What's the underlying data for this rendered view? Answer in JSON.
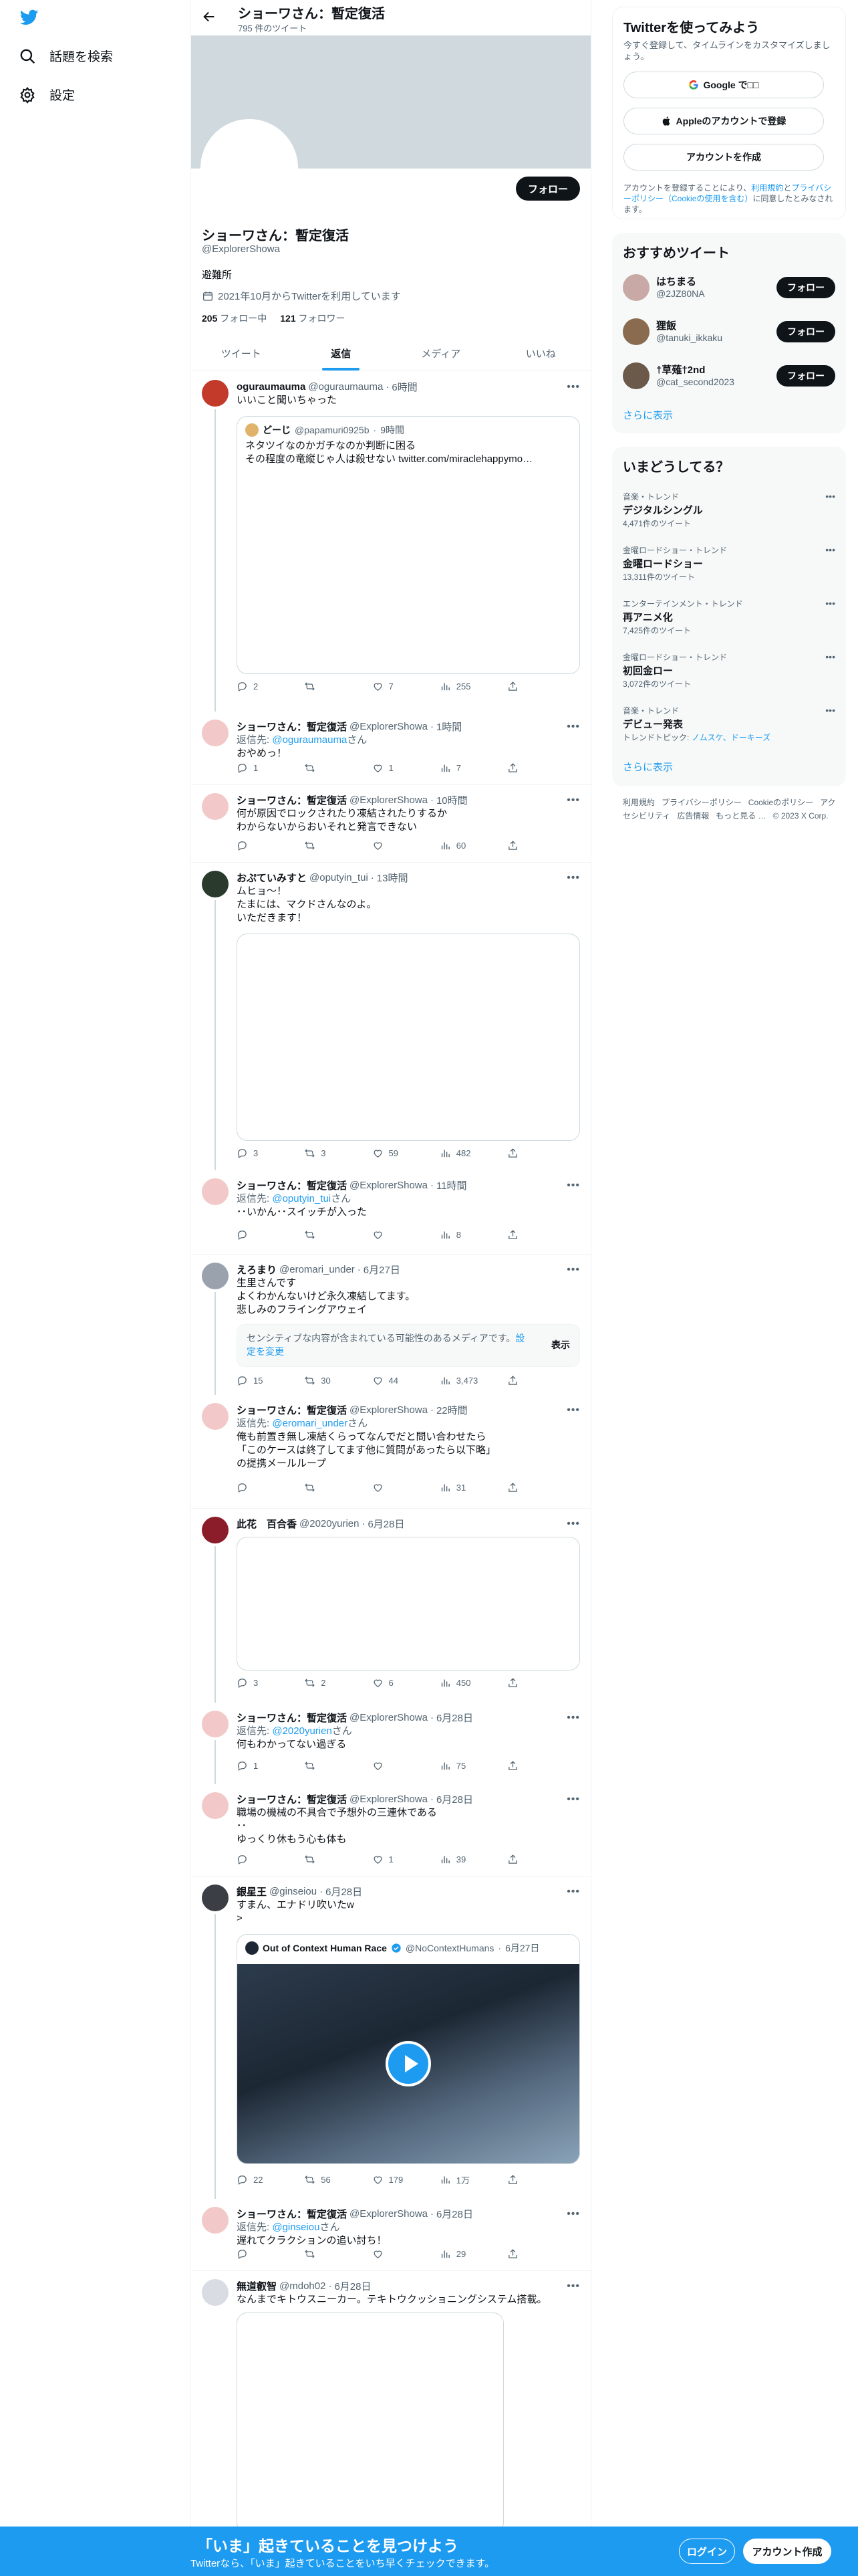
{
  "header": {
    "name": "ショーワさん：暫定復活",
    "tweet_count": "795 件のツイート"
  },
  "leftnav": {
    "explore": "話題を検索",
    "settings": "設定"
  },
  "profile": {
    "name": "ショーワさん：暫定復活",
    "handle": "@ExplorerShowa",
    "bio": "避難所",
    "joined": "2021年10月からTwitterを利用しています",
    "following_count": "205",
    "following_label": "フォロー中",
    "followers_count": "121",
    "followers_label": "フォロワー",
    "follow_button": "フォロー"
  },
  "tabs": [
    "ツイート",
    "返信",
    "メディア",
    "いいね"
  ],
  "tweets": [
    {
      "name": "oguraumauma",
      "handle": "@oguraumauma",
      "time": "6時間",
      "text": "いいこと聞いちゃった",
      "quote": {
        "name": "どーじ",
        "handle": "@papamuri0925b",
        "time": "9時間",
        "text": "ネタツイなのかガチなのか判断に困る\nその程度の竜縦じゃ人は殺せない twitter.com/miraclehappymo…"
      },
      "stats": {
        "replies": "2",
        "retweets": "",
        "likes": "7",
        "views": "255"
      }
    },
    {
      "name": "ショーワさん：暫定復活",
      "handle": "@ExplorerShowa",
      "time": "1時間",
      "reply_prefix": "返信先: ",
      "reply_to": "@oguraumauma",
      "reply_suffix": "さん",
      "text": "おやめっ！",
      "stats": {
        "replies": "1",
        "retweets": "",
        "likes": "1",
        "views": "7"
      }
    },
    {
      "name": "ショーワさん：暫定復活",
      "handle": "@ExplorerShowa",
      "time": "10時間",
      "text": "何が原因でロックされたり凍結されたりするか\nわからないからおいそれと発言できない",
      "stats": {
        "replies": "",
        "retweets": "",
        "likes": "",
        "views": "60"
      }
    },
    {
      "name": "おぷていみすと",
      "handle": "@oputyin_tui",
      "time": "13時間",
      "text": "ムヒョ～！\nたまには、マクドさんなのよ。\nいただきます！",
      "stats": {
        "replies": "3",
        "retweets": "3",
        "likes": "59",
        "views": "482"
      }
    },
    {
      "name": "ショーワさん：暫定復活",
      "handle": "@ExplorerShowa",
      "time": "11時間",
      "reply_prefix": "返信先: ",
      "reply_to": "@oputyin_tui",
      "reply_suffix": "さん",
      "text": "･･いかん･･スイッチが入った",
      "stats": {
        "replies": "",
        "retweets": "",
        "likes": "",
        "views": "8"
      }
    },
    {
      "name": "えろまり",
      "handle": "@eromari_under",
      "time": "6月27日",
      "text": "生里さんです\nよくわかんないけど永久凍結してます。\n悲しみのフライングアウェイ",
      "sensitive": {
        "text": "センシティブな内容が含まれている可能性のあるメディアです。",
        "link": "設定を変更",
        "show": "表示"
      },
      "stats": {
        "replies": "15",
        "retweets": "30",
        "likes": "44",
        "views": "3,473"
      }
    },
    {
      "name": "ショーワさん：暫定復活",
      "handle": "@ExplorerShowa",
      "time": "22時間",
      "reply_prefix": "返信先: ",
      "reply_to": "@eromari_under",
      "reply_suffix": "さん",
      "text": "俺も前置き無し凍結くらってなんでだと問い合わせたら\n「このケースは終了してます他に質問があったら以下略」\nの提携メールループ",
      "stats": {
        "replies": "",
        "retweets": "",
        "likes": "",
        "views": "31"
      }
    },
    {
      "name": "此花　百合香",
      "handle": "@2020yurien",
      "time": "6月28日",
      "text": "",
      "stats": {
        "replies": "3",
        "retweets": "2",
        "likes": "6",
        "views": "450"
      }
    },
    {
      "name": "ショーワさん：暫定復活",
      "handle": "@ExplorerShowa",
      "time": "6月28日",
      "reply_prefix": "返信先: ",
      "reply_to": "@2020yurien",
      "reply_suffix": "さん",
      "text": "何もわかってない過ぎる",
      "stats": {
        "replies": "1",
        "retweets": "",
        "likes": "",
        "views": "75"
      }
    },
    {
      "name": "ショーワさん：暫定復活",
      "handle": "@ExplorerShowa",
      "time": "6月28日",
      "text": "職場の機械の不具合で予想外の三連休である\n･･\nゆっくり休もう心も体も",
      "stats": {
        "replies": "",
        "retweets": "",
        "likes": "1",
        "views": "39"
      }
    },
    {
      "name": "銀星王",
      "handle": "@ginseiou",
      "time": "6月28日",
      "text": "すまん、エナドリ吹いたw\n>",
      "quote": {
        "name": "Out of Context Human Race",
        "handle": "@NoContextHumans",
        "time": "6月27日",
        "text": ""
      },
      "stats": {
        "replies": "22",
        "retweets": "56",
        "likes": "179",
        "views": "1万"
      }
    },
    {
      "name": "ショーワさん：暫定復活",
      "handle": "@ExplorerShowa",
      "time": "6月28日",
      "reply_prefix": "返信先: ",
      "reply_to": "@ginseiou",
      "reply_suffix": "さん",
      "text": "遅れてクラクションの追い討ち！",
      "stats": {
        "replies": "",
        "retweets": "",
        "likes": "",
        "views": "29"
      }
    },
    {
      "name": "無道叡智",
      "handle": "@mdoh02",
      "time": "6月28日",
      "text": "なんまでキトウスニーカー。テキトウクッショニングシステム搭載。",
      "stats": {
        "replies": "",
        "retweets": "",
        "likes": "",
        "views": ""
      }
    }
  ],
  "sidebar": {
    "signup": {
      "title": "Twitterを使ってみよう",
      "desc": "今すぐ登録して、タイムラインをカスタマイズしましょう。",
      "google": "Google で□□",
      "apple": "Appleのアカウントで登録",
      "create": "アカウントを作成",
      "legal_prefix": "アカウントを登録することにより、",
      "terms": "利用規約",
      "and": "と",
      "privacy": "プライバシーポリシー",
      "cookie": "（Cookieの使用を含む）",
      "legal_suffix": "に同意したとみなされます。"
    },
    "recommend": {
      "title": "おすすめツイート",
      "users": [
        {
          "name": "はちまる",
          "handle": "@2JZ80NA"
        },
        {
          "name": "狸飯",
          "handle": "@tanuki_ikkaku"
        },
        {
          "name": "†草薙†2nd",
          "handle": "@cat_second2023"
        }
      ],
      "follow": "フォロー",
      "more": "さらに表示"
    },
    "trends": {
      "title": "いまどうしてる？",
      "items": [
        {
          "meta": "音楽・トレンド",
          "title": "デジタルシングル",
          "count": "4,471件のツイート"
        },
        {
          "meta": "金曜ロードショー・トレンド",
          "title": "金曜ロードショー",
          "count": "13,311件のツイート"
        },
        {
          "meta": "エンターテインメント・トレンド",
          "title": "再アニメ化",
          "count": "7,425件のツイート"
        },
        {
          "meta": "金曜ロードショー・トレンド",
          "title": "初回金ロー",
          "count": "3,072件のツイート"
        },
        {
          "meta": "音楽・トレンド",
          "title": "デビュー発表",
          "count_prefix": "トレンドトピック: ",
          "count_links": "ノムスケ、ドーキーズ"
        }
      ],
      "more": "さらに表示"
    },
    "footer": [
      "利用規約",
      "プライバシーポリシー",
      "Cookieのポリシー",
      "アクセシビリティ",
      "広告情報",
      "もっと見る …",
      "© 2023 X Corp."
    ]
  },
  "bottom_bar": {
    "title": "「いま」起きていることを見つけよう",
    "subtitle": "Twitterなら、「いま」起きていることをいち早くチェックできます。",
    "login": "ログイン",
    "signup": "アカウント作成"
  },
  "colors": {
    "accent": "#1d9bf0",
    "text": "#0f1419",
    "muted": "#536471"
  }
}
